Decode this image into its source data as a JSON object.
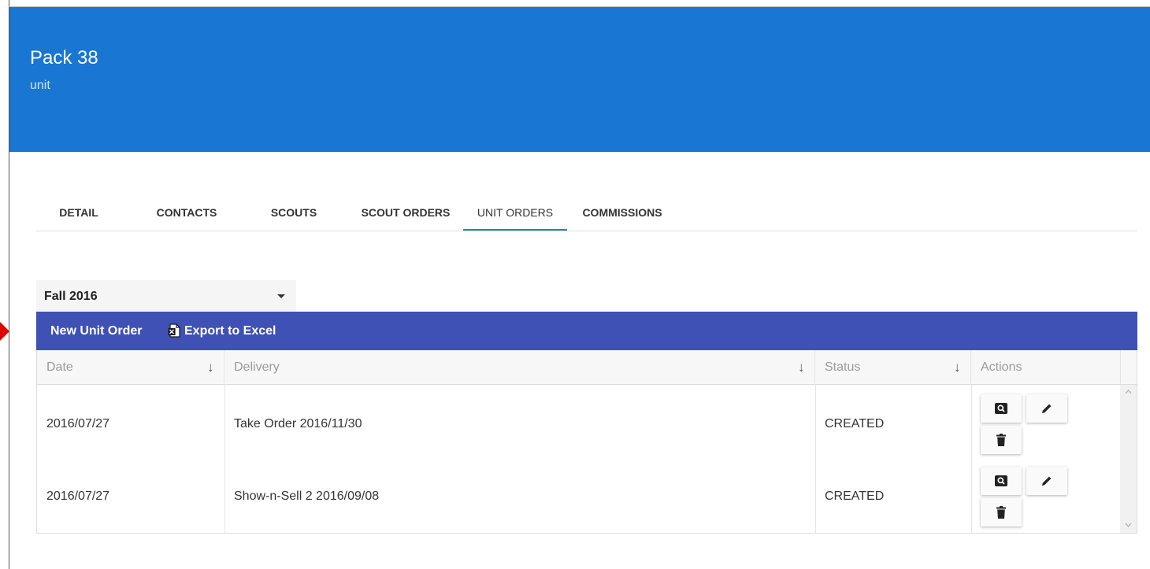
{
  "header": {
    "title": "Pack 38",
    "subtitle": "unit"
  },
  "tabs": [
    {
      "label": "DETAIL",
      "active": false
    },
    {
      "label": "CONTACTS",
      "active": false
    },
    {
      "label": "SCOUTS",
      "active": false
    },
    {
      "label": "SCOUT ORDERS",
      "active": false
    },
    {
      "label": "UNIT ORDERS",
      "active": true
    },
    {
      "label": "COMMISSIONS",
      "active": false
    }
  ],
  "season_select": {
    "value": "Fall 2016"
  },
  "toolbar": {
    "new_label": "New Unit Order",
    "export_label": "Export to Excel",
    "export_icon": "excel-file-icon"
  },
  "grid": {
    "columns": [
      "Date",
      "Delivery",
      "Status",
      "Actions"
    ],
    "sort_indicator": "↓",
    "rows": [
      {
        "date": "2016/07/27",
        "delivery": "Take Order 2016/11/30",
        "status": "CREATED"
      },
      {
        "date": "2016/07/27",
        "delivery": "Show-n-Sell 2 2016/09/08",
        "status": "CREATED"
      }
    ],
    "action_icons": [
      "view-icon",
      "edit-icon",
      "delete-icon"
    ]
  },
  "colors": {
    "header_bg": "#1976d2",
    "toolbar_bg": "#3f51b5",
    "tab_indicator": "#1e88b0",
    "pointer_arrow": "#e00000"
  }
}
